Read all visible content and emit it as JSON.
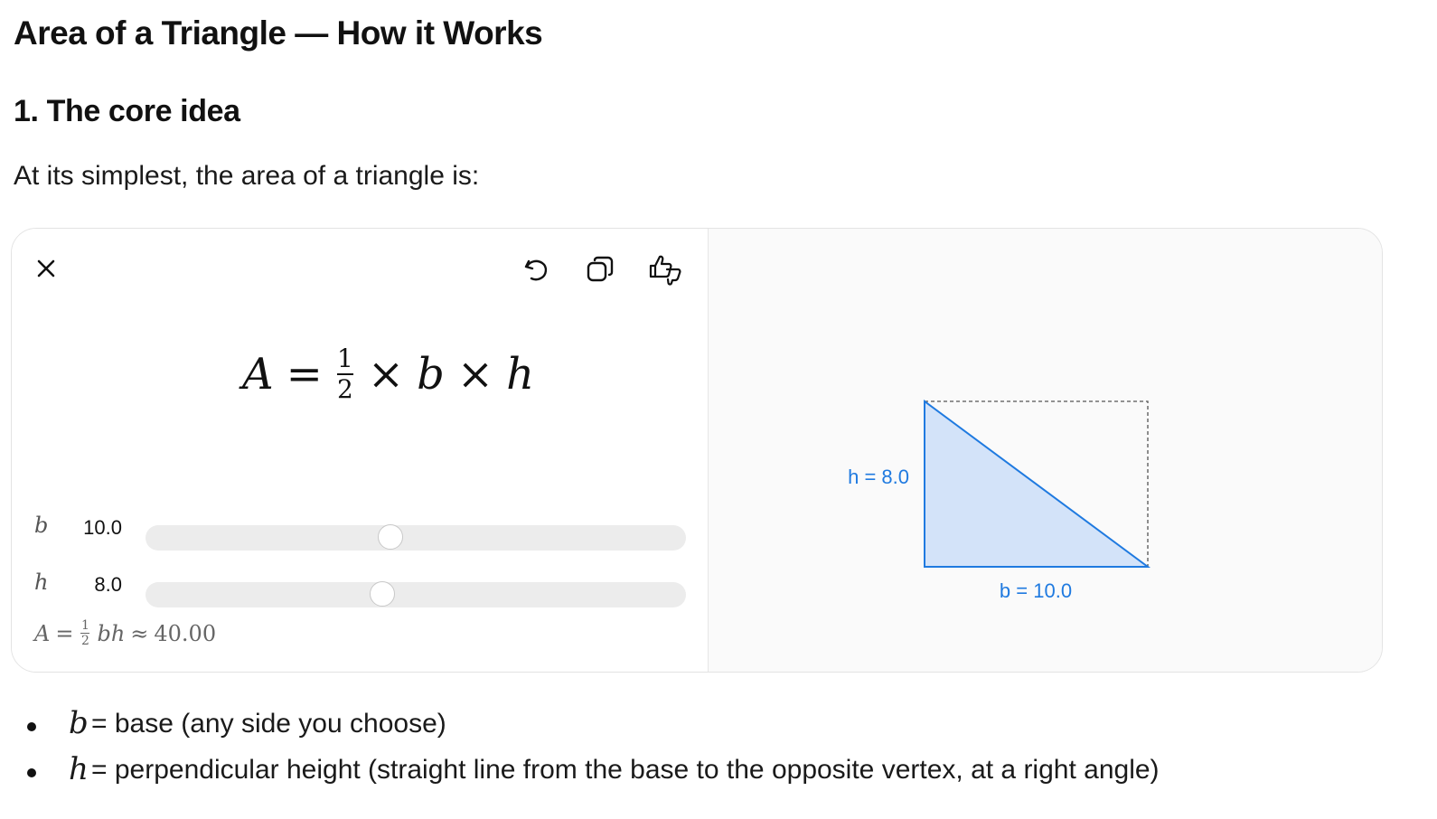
{
  "page": {
    "title": "Area of a Triangle — How it Works",
    "section_heading": "1. The core idea",
    "intro": "At its simplest, the area of a triangle is:"
  },
  "widget": {
    "toolbar": {
      "close_icon": "close-icon",
      "undo_icon": "undo-icon",
      "copy_icon": "copy-icon",
      "feedback_icon": "thumbs-up-down-icon"
    },
    "formula": {
      "lhs": "A",
      "eq": "=",
      "frac_num": "1",
      "frac_den": "2",
      "times1": "×",
      "b": "b",
      "times2": "×",
      "h": "h"
    },
    "sliders": [
      {
        "symbol": "b",
        "value_text": "10.0",
        "value": 10.0,
        "fraction": 0.45
      },
      {
        "symbol": "h",
        "value_text": "8.0",
        "value": 8.0,
        "fraction": 0.435
      }
    ],
    "result": {
      "lhs": "A",
      "eq": "=",
      "frac_num": "1",
      "frac_den": "2",
      "vars": "bh",
      "approx": "≈",
      "value": "40.00"
    },
    "diagram": {
      "height_label": "h = 8.0",
      "base_label": "b = 10.0",
      "fill_color": "#d3e3f9",
      "stroke_color": "#1f7ae0"
    }
  },
  "definitions": [
    {
      "symbol": "b",
      "text": " = base (any side you choose)"
    },
    {
      "symbol": "h",
      "text": " = perpendicular height (straight line from the base to the opposite vertex, at a right angle)"
    }
  ]
}
